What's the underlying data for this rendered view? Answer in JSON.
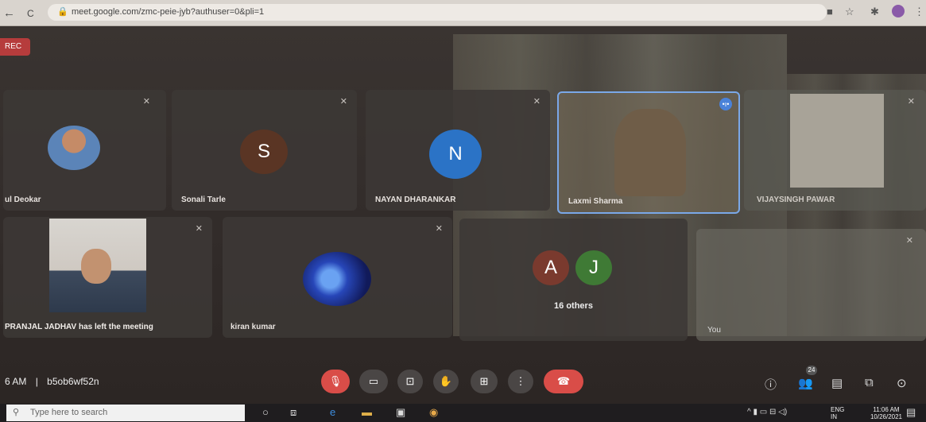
{
  "browser": {
    "url": "meet.google.com/zmc-peie-jyb?authuser=0&pli=1",
    "nav": {
      "back_icon": "←",
      "forward_icon": "→",
      "reload_icon": "C"
    }
  },
  "meeting": {
    "rec_label": "REC",
    "time": "6 AM",
    "separator": "|",
    "code": "b5ob6wf52n",
    "people_count": "24"
  },
  "tiles": [
    {
      "name": "ul Deokar"
    },
    {
      "name": "Sonali Tarle",
      "initial": "S"
    },
    {
      "name": "NAYAN DHARANKAR",
      "initial": "N"
    },
    {
      "name": "Laxmi Sharma"
    },
    {
      "name": "VIJAYSINGH PAWAR"
    },
    {
      "name": "PRANJAL JADHAV has left the meeting"
    },
    {
      "name": "kiran kumar"
    },
    {
      "name": "16 others",
      "initials": [
        "A",
        "J"
      ]
    },
    {
      "name": "You"
    }
  ],
  "taskbar": {
    "search_placeholder": "Type here to search",
    "lang": "ENG",
    "lang_region": "IN",
    "time": "11:06 AM",
    "date": "10/26/2021"
  },
  "colors": {
    "avatar_n": "#2b73c6",
    "avatar_s": "#5a3524",
    "avatar_a": "#7a3a2e",
    "avatar_j": "#3f7a35",
    "end_call": "#d94d48",
    "mute_red": "#d94d48"
  }
}
